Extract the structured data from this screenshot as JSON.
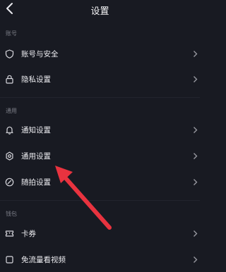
{
  "header": {
    "title": "设置"
  },
  "sections": [
    {
      "label": "账号",
      "items": [
        {
          "label": "账号与安全",
          "icon": "shield-icon"
        },
        {
          "label": "隐私设置",
          "icon": "lock-icon"
        }
      ]
    },
    {
      "label": "通用",
      "items": [
        {
          "label": "通知设置",
          "icon": "bell-icon"
        },
        {
          "label": "通用设置",
          "icon": "gear-icon"
        },
        {
          "label": "随拍设置",
          "icon": "snap-icon"
        }
      ]
    },
    {
      "label": "钱包",
      "items": [
        {
          "label": "卡券",
          "icon": "ticket-icon"
        },
        {
          "label": "免流量看视频",
          "icon": "data-icon"
        }
      ]
    }
  ],
  "annotation": {
    "arrow_color": "#e8333f"
  }
}
